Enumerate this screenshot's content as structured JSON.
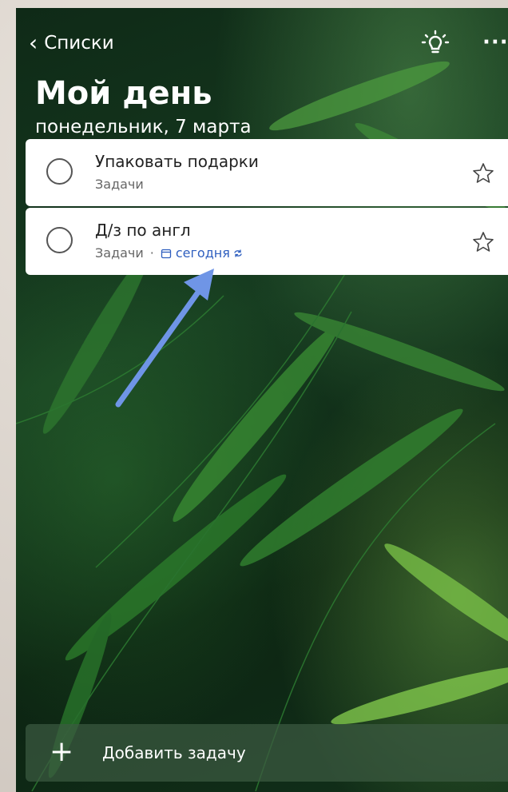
{
  "header": {
    "back_label": "Списки",
    "title": "Мой день",
    "date": "понедельник, 7 марта"
  },
  "tasks": [
    {
      "title": "Упаковать подарки",
      "list": "Задачи",
      "due": "",
      "starred": false
    },
    {
      "title": "Д/з по англ",
      "list": "Задачи",
      "separator": "·",
      "due": "сегодня",
      "repeat": true,
      "starred": false
    }
  ],
  "add_task": {
    "label": "Добавить задачу"
  },
  "icons": {
    "back": "chevron-left-icon",
    "suggestions": "lightbulb-icon",
    "more": "more-icon",
    "complete": "circle-icon",
    "star": "star-icon",
    "calendar": "calendar-icon",
    "repeat": "repeat-icon",
    "add": "plus-icon"
  },
  "colors": {
    "accent_due": "#2f5fbf",
    "annotation_arrow": "#6f95e6",
    "card": "#ffffff"
  }
}
